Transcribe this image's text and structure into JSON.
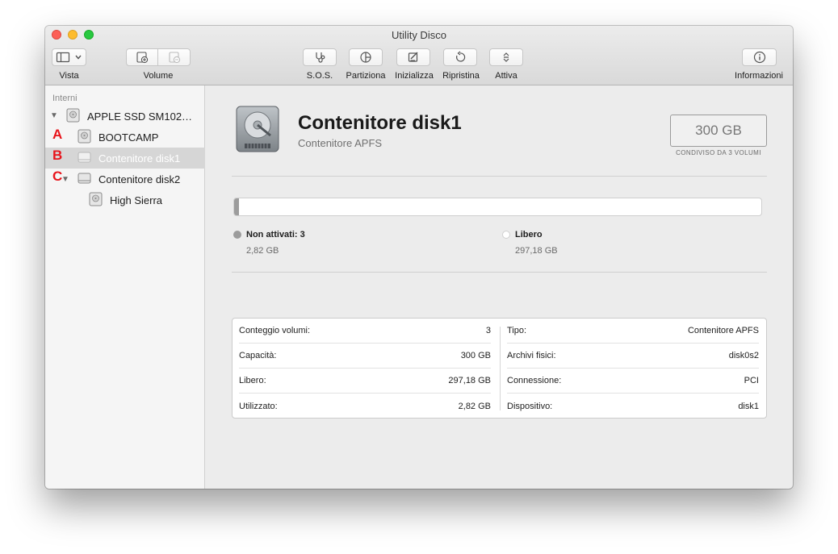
{
  "window": {
    "title": "Utility Disco"
  },
  "toolbar": {
    "vista_label": "Vista",
    "volume_label": "Volume",
    "sos_label": "S.O.S.",
    "partiziona_label": "Partiziona",
    "inizializza_label": "Inizializza",
    "ripristina_label": "Ripristina",
    "attiva_label": "Attiva",
    "informazioni_label": "Informazioni"
  },
  "sidebar": {
    "section": "Interni",
    "items": [
      {
        "label": "APPLE SSD SM102…",
        "marker": ""
      },
      {
        "label": "BOOTCAMP",
        "marker": "A"
      },
      {
        "label": "Contenitore disk1",
        "marker": "B"
      },
      {
        "label": "Contenitore disk2",
        "marker": "C"
      },
      {
        "label": "High Sierra",
        "marker": ""
      }
    ]
  },
  "header": {
    "title": "Contenitore disk1",
    "subtitle": "Contenitore APFS",
    "size": "300 GB",
    "size_caption": "CONDIVISO DA 3 VOLUMI"
  },
  "usage": {
    "used_fraction": 0.0094,
    "used_color": "#9c9c9c",
    "free_color": "#ffffff",
    "used_title": "Non attivati: 3",
    "used_value": "2,82 GB",
    "free_title": "Libero",
    "free_value": "297,18 GB"
  },
  "info": {
    "left": [
      {
        "label": "Conteggio volumi:",
        "value": "3"
      },
      {
        "label": "Capacità:",
        "value": "300 GB"
      },
      {
        "label": "Libero:",
        "value": "297,18 GB"
      },
      {
        "label": "Utilizzato:",
        "value": "2,82 GB"
      }
    ],
    "right": [
      {
        "label": "Tipo:",
        "value": "Contenitore APFS"
      },
      {
        "label": "Archivi fisici:",
        "value": "disk0s2"
      },
      {
        "label": "Connessione:",
        "value": "PCI"
      },
      {
        "label": "Dispositivo:",
        "value": "disk1"
      }
    ]
  },
  "icons": {
    "sidebar_toggle": "sidebar-icon",
    "add_volume": "add-volume-icon",
    "remove_volume": "remove-volume-icon",
    "sos": "stethoscope-icon",
    "partition": "pie-icon",
    "erase": "erase-icon",
    "restore": "restore-icon",
    "mount": "mount-icon",
    "info": "info-icon"
  }
}
